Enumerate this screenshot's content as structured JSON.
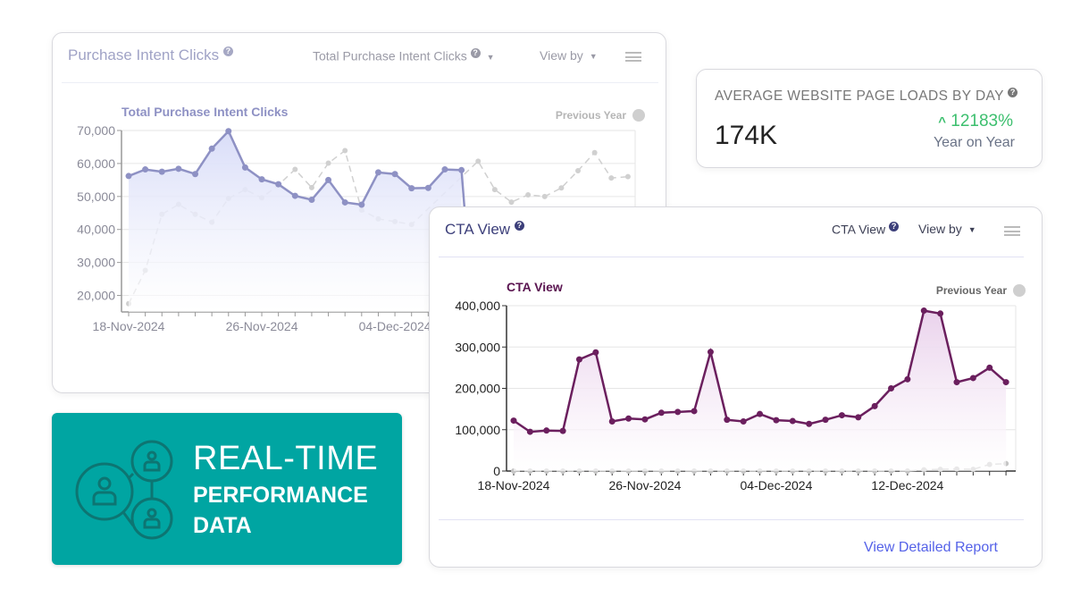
{
  "purchase_card": {
    "title": "Purchase Intent Clicks",
    "metric_dropdown": "Total Purchase Intent Clicks",
    "view_by": "View by",
    "chart_data": {
      "type": "area",
      "title": "Total Purchase Intent Clicks",
      "legend": [
        "Previous Year"
      ],
      "legend_placement": "top-right",
      "x_tick_labels": [
        "18-Nov-2024",
        "26-Nov-2024",
        "04-Dec-2024"
      ],
      "x_start": "18-Nov-2024",
      "x_end": "18-Dec-2024",
      "y_tick_labels": [
        "20,000",
        "30,000",
        "40,000",
        "50,000",
        "60,000",
        "70,000"
      ],
      "ylim": [
        15000,
        70000
      ],
      "grid": true,
      "series": [
        {
          "values": [
            56200,
            58200,
            57500,
            58400,
            56800,
            64500,
            69800,
            58800,
            55200,
            53700,
            50200,
            49000,
            55000,
            48200,
            47500,
            57300,
            56800,
            52500,
            52600,
            58200,
            58000,
            null,
            null,
            null,
            null,
            null,
            null,
            null,
            null,
            null,
            null
          ],
          "color": "#8e91c4"
        },
        {
          "name": "Previous Year",
          "values": [
            17500,
            27600,
            44600,
            47600,
            44600,
            42200,
            49400,
            52100,
            49600,
            53500,
            58200,
            52700,
            60100,
            63900,
            45900,
            43200,
            42400,
            41500,
            null,
            null,
            null,
            60700,
            52100,
            48300,
            50500,
            50000,
            52600,
            57800,
            63300,
            55600,
            56000
          ],
          "color": "#d0d0d0",
          "dashed": true
        }
      ]
    }
  },
  "kpi": {
    "label": "AVERAGE WEBSITE PAGE LOADS BY DAY",
    "value": "174K",
    "change": "12183%",
    "change_direction": "up",
    "change_color": "#3cbf6e",
    "comparison": "Year on Year"
  },
  "cta_card": {
    "title": "CTA View",
    "metric_dropdown": "CTA View",
    "view_by": "View by",
    "report_link": "View Detailed Report",
    "chart_data": {
      "type": "area",
      "title": "CTA View",
      "legend": [
        "Previous Year"
      ],
      "legend_placement": "top-right",
      "x_tick_labels": [
        "18-Nov-2024",
        "26-Nov-2024",
        "04-Dec-2024",
        "12-Dec-2024"
      ],
      "x_start": "18-Nov-2024",
      "x_end": "18-Dec-2024",
      "y_tick_labels": [
        "0",
        "100,000",
        "200,000",
        "300,000",
        "400,000"
      ],
      "ylim": [
        0,
        400000
      ],
      "grid": true,
      "series": [
        {
          "values": [
            122000,
            95000,
            98000,
            97000,
            270000,
            287000,
            120000,
            127000,
            125000,
            141000,
            143000,
            145000,
            288000,
            124000,
            120000,
            138000,
            123000,
            121000,
            114000,
            124000,
            135000,
            130000,
            157000,
            200000,
            222000,
            388000,
            381000,
            215000,
            225000,
            250000,
            215000
          ],
          "color": "#6b1f5e"
        },
        {
          "name": "Previous Year",
          "values": [
            0,
            0,
            0,
            0,
            0,
            0,
            0,
            0,
            0,
            0,
            0,
            0,
            0,
            0,
            0,
            0,
            0,
            0,
            0,
            0,
            0,
            0,
            0,
            0,
            0,
            3000,
            4000,
            5000,
            4000,
            16000,
            18000
          ],
          "color": "#c4c4c4",
          "dashed": true
        }
      ]
    }
  },
  "banner": {
    "line1": "REAL-TIME",
    "line2": "PERFORMANCE",
    "line3": "DATA",
    "color": "#00a5a2",
    "icon": "people-network-icon"
  }
}
